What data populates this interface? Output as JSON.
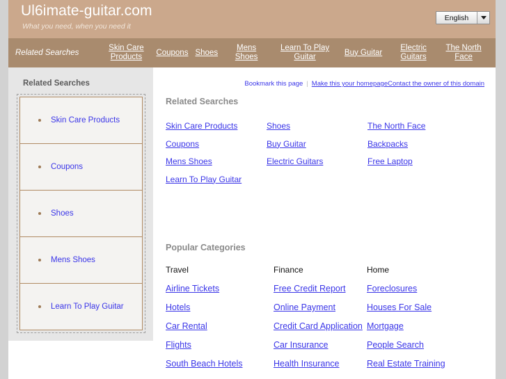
{
  "header": {
    "site_title": "Ul6imate-guitar.com",
    "tagline": "What you need, when you need it",
    "language": {
      "selected": "English",
      "arrow_icon": "chevron-down-icon"
    }
  },
  "navbar": {
    "label": "Related Searches",
    "links": [
      "Skin Care Products",
      "Coupons",
      "Shoes",
      "Mens Shoes",
      "Learn To Play Guitar",
      "Buy Guitar",
      "Electric Guitars",
      "The North Face"
    ]
  },
  "sidebar": {
    "title": "Related Searches",
    "items": [
      "Skin Care Products",
      "Coupons",
      "Shoes",
      "Mens Shoes",
      "Learn To Play Guitar"
    ]
  },
  "topbar": {
    "bookmark": "Bookmark this page",
    "separator": "|",
    "homepage": "Make this your homepage",
    "contact": "Contact the owner of this domain"
  },
  "related_searches": {
    "title": "Related Searches",
    "links": [
      "Skin Care Products",
      "Shoes",
      "The North Face",
      "Coupons",
      "Buy Guitar",
      "Backpacks",
      "Mens Shoes",
      "Electric Guitars",
      "Free Laptop",
      "Learn To Play Guitar"
    ]
  },
  "popular_categories": {
    "title": "Popular Categories",
    "columns": [
      {
        "heading": "Travel",
        "links": [
          "Airline Tickets",
          "Hotels",
          "Car Rental",
          "Flights",
          "South Beach Hotels"
        ]
      },
      {
        "heading": "Finance",
        "links": [
          "Free Credit Report",
          "Online Payment",
          "Credit Card Application",
          "Car Insurance",
          "Health Insurance"
        ]
      },
      {
        "heading": "Home",
        "links": [
          "Foreclosures",
          "Houses For Sale",
          "Mortgage",
          "People Search",
          "Real Estate Training"
        ]
      }
    ]
  },
  "colors": {
    "header_bg": "#cba88c",
    "nav_bg": "#a98b6e",
    "link": "#3a35e8",
    "sidebar_bg": "#e6e6e6",
    "box_border": "#b08a62",
    "page_margin": "#d2d2d2"
  }
}
